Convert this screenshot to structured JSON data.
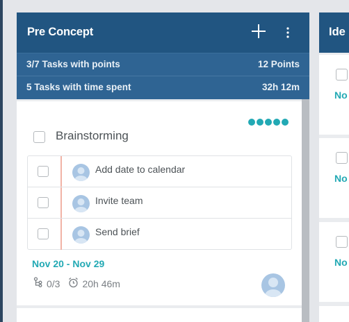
{
  "column": {
    "title": "Pre Concept",
    "add_icon": "plus-icon",
    "more_icon": "vertical-dots-icon",
    "stats": [
      {
        "left": "3/7 Tasks with points",
        "right": "12 Points"
      },
      {
        "left": "5 Tasks with time spent",
        "right": "32h 12m"
      }
    ]
  },
  "card": {
    "title": "Brainstorming",
    "priority_dots": 5,
    "subtasks": [
      {
        "label": "Add date to calendar"
      },
      {
        "label": "Invite team"
      },
      {
        "label": "Send brief"
      }
    ],
    "date_range": "Nov 20 - Nov 29",
    "subtask_count": "0/3",
    "time_spent": "20h 46m"
  },
  "next_column": {
    "title": "Ide",
    "cards": [
      {
        "date": "No"
      },
      {
        "date": "No"
      },
      {
        "date": "No"
      }
    ]
  },
  "colors": {
    "header": "#215581",
    "stat_row": "#2f6493",
    "accent": "#22a9b4"
  }
}
